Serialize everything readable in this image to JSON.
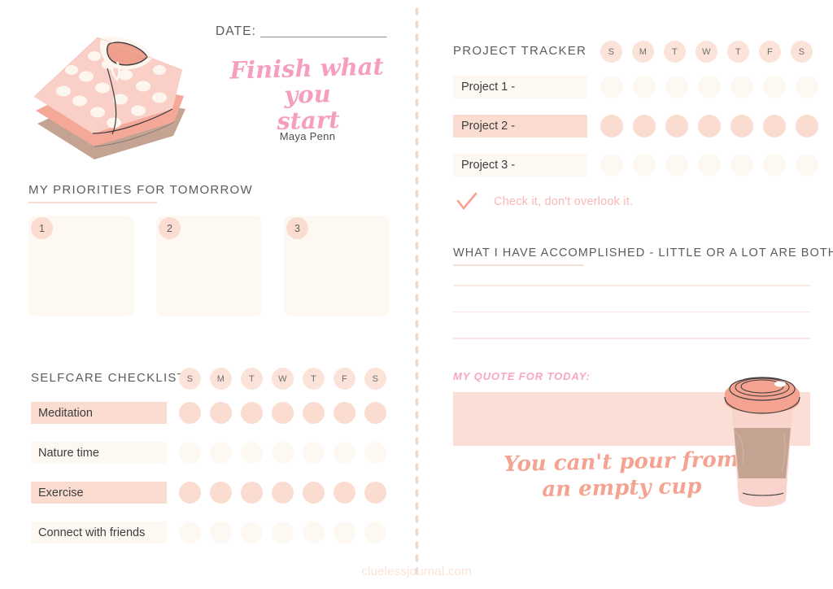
{
  "header": {
    "date_label": "DATE:",
    "date_line": "___________________",
    "quote_line1": "Finish what you",
    "quote_line2": "start",
    "quote_author": "Maya Penn",
    "clothes_illustration": "folded-clothes-illustration"
  },
  "priorities": {
    "heading": "MY PRIORITIES FOR TOMORROW",
    "cards": [
      {
        "number": "1",
        "value": ""
      },
      {
        "number": "2",
        "value": ""
      },
      {
        "number": "3",
        "value": ""
      }
    ]
  },
  "selfcare": {
    "heading": "SELFCARE CHECKLIST",
    "days": [
      "S",
      "M",
      "T",
      "W",
      "T",
      "F",
      "S"
    ],
    "rows": [
      {
        "label": "Meditation",
        "tone": "pink"
      },
      {
        "label": "Nature time",
        "tone": "cream"
      },
      {
        "label": "Exercise",
        "tone": "pink"
      },
      {
        "label": "Connect with friends",
        "tone": "cream"
      }
    ]
  },
  "project_tracker": {
    "heading": "PROJECT TRACKER",
    "days": [
      "S",
      "M",
      "T",
      "W",
      "T",
      "F",
      "S"
    ],
    "rows": [
      {
        "label": "Project 1 -",
        "tone": "cream"
      },
      {
        "label": "Project 2 -",
        "tone": "pink"
      },
      {
        "label": "Project 3 -",
        "tone": "cream"
      }
    ],
    "note": "Check it, don't overlook it.",
    "note_icon": "check-icon"
  },
  "accomplished": {
    "heading": "WHAT I HAVE ACCOMPLISHED - LITTLE OR A LOT ARE BOTH GOOD",
    "line_count": 3
  },
  "quote_today": {
    "heading": "MY QUOTE FOR TODAY:",
    "value": "",
    "script_line1": "You can't pour from",
    "script_line2": "an empty cup",
    "coffee_illustration": "coffee-cup-illustration"
  },
  "footer": {
    "website": "cluelessjournal.com"
  },
  "colors": {
    "pink_fill": "#fadcd1",
    "cream_fill": "#fdf8f2",
    "day_chip": "#fbe3da",
    "accent_script": "#f59ec0",
    "accent_coral": "#f4a391",
    "divider_dot": "#f2d9c8",
    "footer_text": "#fae2d8"
  }
}
